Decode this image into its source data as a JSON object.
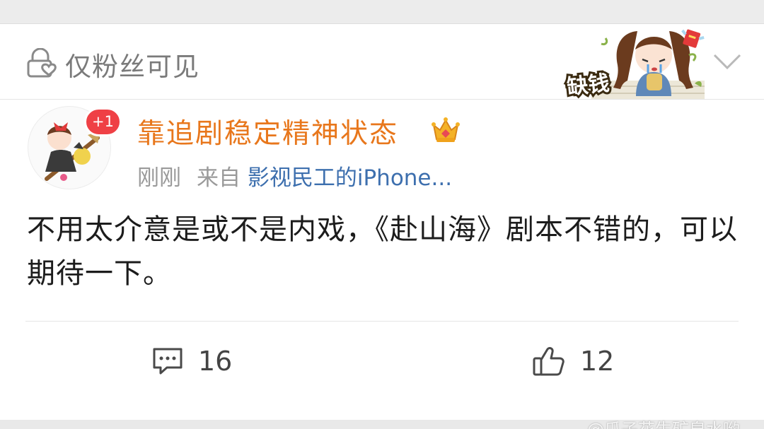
{
  "visibility": {
    "label": "仅粉丝可见",
    "icon": "lock-heart-icon"
  },
  "sticker": {
    "text": "缺钱"
  },
  "user": {
    "name": "靠追剧稳定精神状态",
    "badge": "+1",
    "crown_icon": "crown-icon",
    "name_color": "#e8771c"
  },
  "meta": {
    "time": "刚刚",
    "from_label": "来自",
    "source": "影视民工的iPhone..."
  },
  "post": {
    "text": "不用太介意是或不是内戏，《赴山海》剧本不错的，可以期待一下。"
  },
  "actions": {
    "comments": "16",
    "likes": "12"
  },
  "watermark": "@瓜子花生矿泉水哟"
}
